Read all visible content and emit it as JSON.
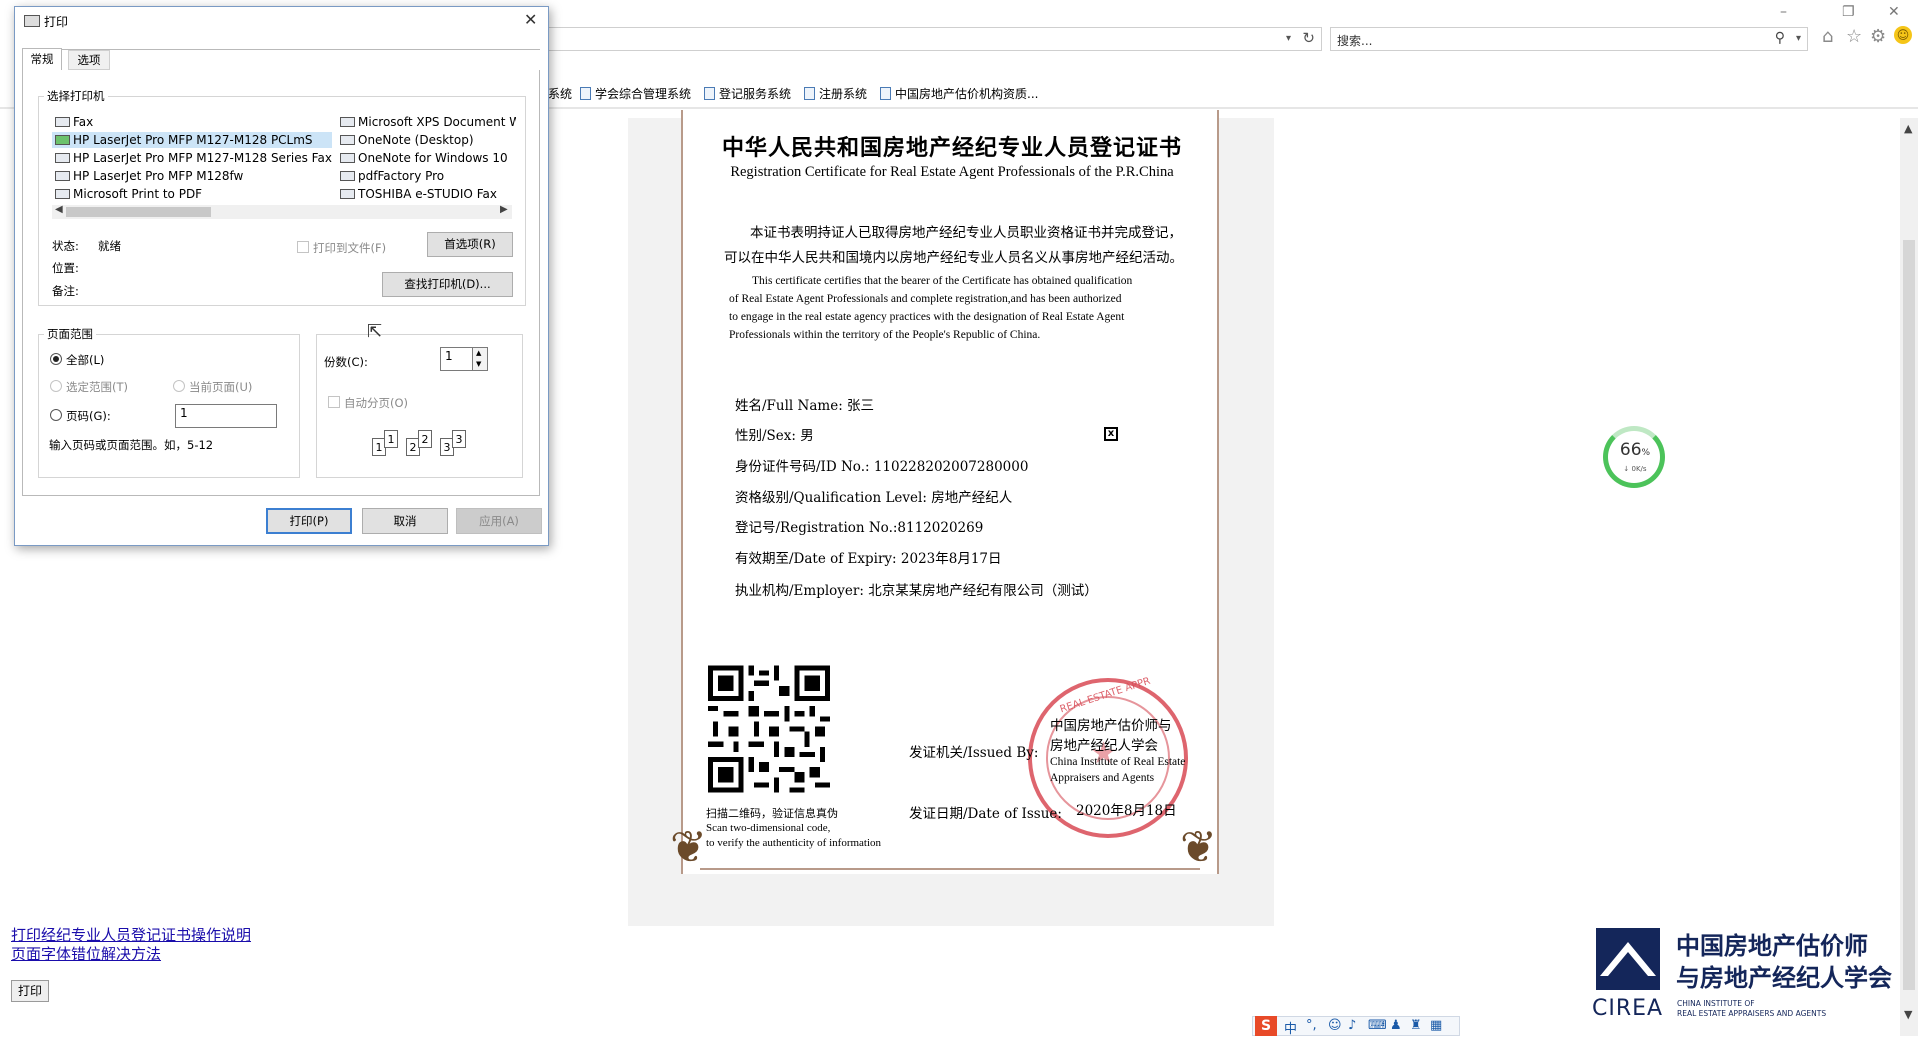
{
  "browser": {
    "search_placeholder": "搜索...",
    "favorites": [
      "系统",
      "学会综合管理系统",
      "登记服务系统",
      "注册系统",
      "中国房地产估价机构资质..."
    ]
  },
  "certificate": {
    "title_cn": "中华人民共和国房地产经纪专业人员登记证书",
    "title_en": "Registration Certificate for Real Estate Agent Professionals of the P.R.China",
    "intro_cn": [
      "本证书表明持证人已取得房地产经纪专业人员职业资格证书并完成登记，",
      "可以在中华人民共和国境内以房地产经纪专业人员名义从事房地产经纪活动。"
    ],
    "intro_en": [
      "This certificate certifies that the bearer of the Certificate has obtained qualification",
      "of Real Estate Agent Professionals and complete registration,and has been authorized",
      "to engage in the real estate agency practices with the designation of Real Estate Agent",
      "Professionals within the territory of the People's Republic of China."
    ],
    "fields": {
      "name": "姓名/Full Name:  张三",
      "sex": "性别/Sex:  男",
      "id_no": "身份证件号码/ID No.: 110228202007280000",
      "level": "资格级别/Qualification Level: 房地产经纪人",
      "reg_no": "登记号/Registration No.:8112020269",
      "expiry": "有效期至/Date of Expiry:   2023年8月17日",
      "employer": "执业机构/Employer:  北京某某房地产经纪有限公司（测试）"
    },
    "sex_box_mark": "x",
    "qr_caption": [
      "扫描二维码，验证信息真伪",
      "Scan two-dimensional code,",
      "to verify the authenticity of information"
    ],
    "issued_by_label": "发证机关/Issued By:",
    "issuer_cn": [
      "中国房地产估价师与",
      "房地产经纪人学会"
    ],
    "issuer_en": [
      "China Institute of Real Estate",
      "Appraisers and Agents"
    ],
    "issue_date_label": "发证日期/Date of Issue:",
    "issue_date": "2020年8月18日",
    "seal_text": "REAL ESTATE APPR"
  },
  "speed_widget": {
    "value": "66",
    "unit": "%",
    "rate": "↓ 0K/s"
  },
  "page_links": [
    "打印经纪专业人员登记证书操作说明",
    "页面字体错位解决方法"
  ],
  "page_print_button": "打印",
  "logo": {
    "abbr": "CIREA",
    "cn_line1": "中国房地产估价师",
    "cn_line2": "与房地产经纪人学会",
    "en_line1": "CHINA INSTITUTE OF",
    "en_line2": "REAL ESTATE APPRAISERS AND AGENTS"
  },
  "ime": {
    "logo": "S",
    "lang": "中"
  },
  "print_dialog": {
    "title": "打印",
    "tabs": [
      "常规",
      "选项"
    ],
    "select_printer_label": "选择打印机",
    "printers_col1": [
      "Fax",
      "HP LaserJet Pro MFP M127-M128 PCLmS",
      "HP LaserJet Pro MFP M127-M128 Series Fax",
      "HP LaserJet Pro MFP M128fw",
      "Microsoft Print to PDF"
    ],
    "printers_col2": [
      "Microsoft XPS Document W",
      "OneNote (Desktop)",
      "OneNote for Windows 10",
      "pdfFactory Pro",
      "TOSHIBA e-STUDIO Fax"
    ],
    "status_label": "状态:",
    "status_value": "就绪",
    "location_label": "位置:",
    "comment_label": "备注:",
    "print_to_file": "打印到文件(F)",
    "preferences_button": "首选项(R)",
    "find_printer_button": "查找打印机(D)...",
    "page_range_label": "页面范围",
    "all_option": "全部(L)",
    "selection_option": "选定范围(T)",
    "current_page_option": "当前页面(U)",
    "pages_option": "页码(G):",
    "pages_value": "1",
    "pages_hint": "输入页码或页面范围。如，5-12",
    "copies_label": "份数(C):",
    "copies_value": "1",
    "collate_label": "自动分页(O)",
    "collate_pages": [
      "1",
      "1",
      "2",
      "2",
      "3",
      "3"
    ],
    "print_button": "打印(P)",
    "cancel_button": "取消",
    "apply_button": "应用(A)"
  }
}
